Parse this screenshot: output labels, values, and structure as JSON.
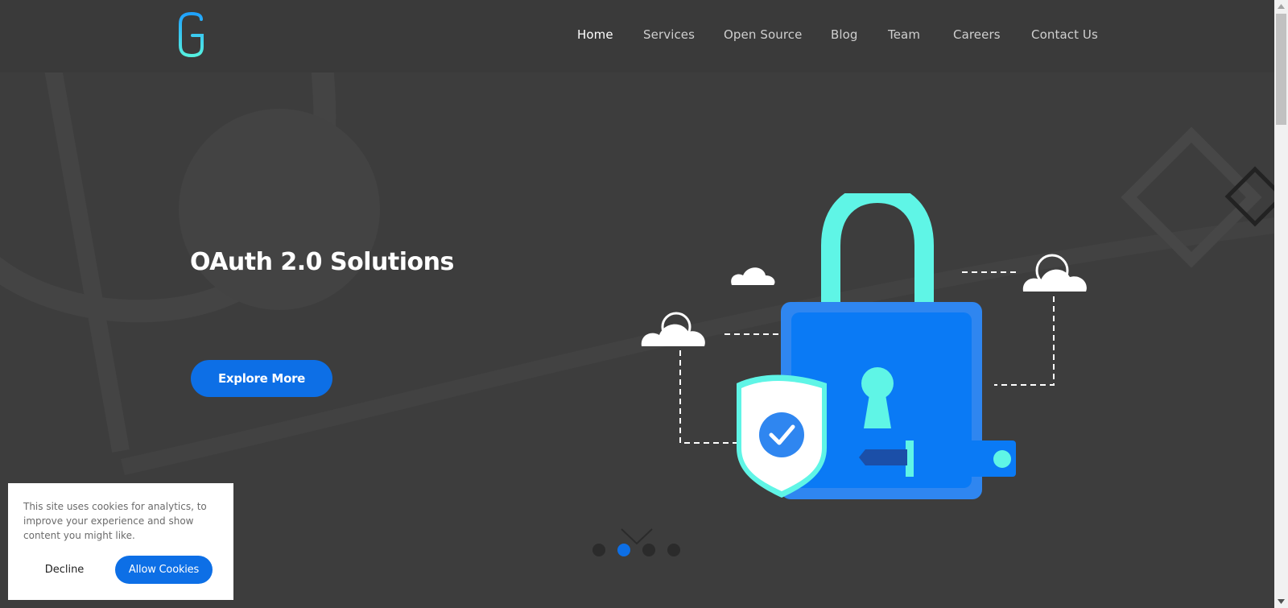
{
  "header": {
    "logo_letter": "G",
    "nav": [
      {
        "label": "Home",
        "active": true
      },
      {
        "label": "Services",
        "active": false
      },
      {
        "label": "Open Source",
        "active": false
      },
      {
        "label": "Blog",
        "active": false
      },
      {
        "label": "Team",
        "active": false
      },
      {
        "label": "Careers",
        "active": false
      },
      {
        "label": "Contact Us",
        "active": false
      }
    ]
  },
  "hero": {
    "title": "OAuth 2.0 Solutions",
    "cta_label": "Explore More",
    "illustration_icon": "padlock-shield-key-clouds-icon",
    "slider": {
      "count": 4,
      "active_index": 1
    }
  },
  "cookie_banner": {
    "text": "This site uses cookies for analytics, to improve your experience and show content you might like.",
    "decline_label": "Decline",
    "allow_label": "Allow Cookies"
  },
  "colors": {
    "background": "#3d3d3d",
    "header_bg": "#3a3a3a",
    "accent_blue": "#0d6fe6",
    "lock_body": "#0a7af5",
    "lock_shackle": "#5ff5e6",
    "white": "#ffffff"
  }
}
